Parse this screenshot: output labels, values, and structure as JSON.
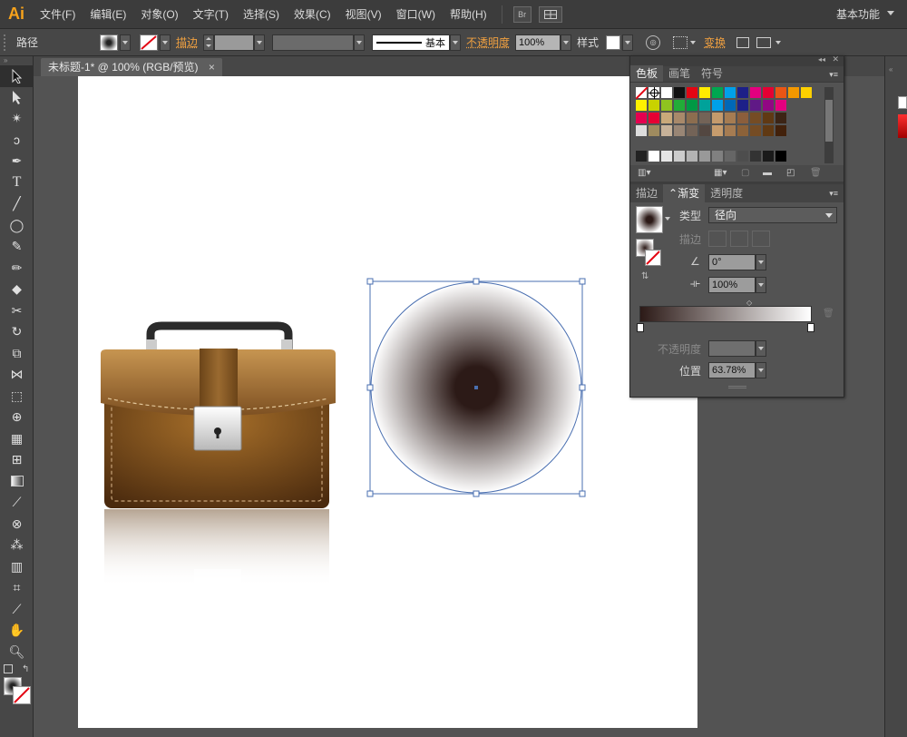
{
  "app": {
    "logo": "Ai",
    "workspace": "基本功能"
  },
  "menu": {
    "items": [
      "文件(F)",
      "编辑(E)",
      "对象(O)",
      "文字(T)",
      "选择(S)",
      "效果(C)",
      "视图(V)",
      "窗口(W)",
      "帮助(H)"
    ],
    "bridge": "Br"
  },
  "control": {
    "object_type": "路径",
    "stroke_label": "描边",
    "stroke_style": "基本",
    "opacity_label": "不透明度",
    "opacity_value": "100%",
    "style_label": "样式",
    "transform_label": "变换"
  },
  "document": {
    "tab_title": "未标题-1* @ 100% (RGB/预览)",
    "close": "×"
  },
  "swatch_panel": {
    "tabs": [
      "色板",
      "画笔",
      "符号"
    ],
    "colors": {
      "row1": [
        "#ffffff",
        "#111111",
        "#e30613",
        "#ffeb00",
        "#00a650",
        "#00a0e9",
        "#1d2088",
        "#e4007f",
        "#e60033",
        "#ea5514",
        "#f39800",
        "#fdd000"
      ],
      "row2": [
        "#fff100",
        "#c9d200",
        "#8fc31f",
        "#22ac38",
        "#009944",
        "#00a29a",
        "#00a0e9",
        "#0068b7",
        "#1d2088",
        "#601986",
        "#920783",
        "#e4007f"
      ],
      "row3": [
        "#e5004f",
        "#e60033",
        "#c9a97a",
        "#a8896a",
        "#8c6d4f",
        "#736357",
        "#c49a6c",
        "#a67c52",
        "#8b5e3c",
        "#754c24",
        "#603913",
        "#3c2415"
      ],
      "row4": [
        "#dddddd",
        "#9f8b5f",
        "#c7b299",
        "#998675",
        "#736357",
        "#534741",
        "#c69c6d",
        "#a67c52",
        "#8c6239",
        "#754c24",
        "#603913",
        "#42210b"
      ],
      "grays": [
        "#ffffff",
        "#e6e6e6",
        "#cccccc",
        "#b3b3b3",
        "#999999",
        "#808080",
        "#666666",
        "#4d4d4d",
        "#333333",
        "#1a1a1a",
        "#000000"
      ]
    }
  },
  "gradient_panel": {
    "tabs": [
      "描边",
      "渐变",
      "透明度"
    ],
    "type_label": "类型",
    "type_value": "径向",
    "stroke_label": "描边",
    "angle_value": "0°",
    "aspect_value": "100%",
    "opacity_label": "不透明度",
    "location_label": "位置",
    "location_value": "63.78%",
    "colors": {
      "start": "#2c1a17",
      "end": "#ffffff"
    }
  },
  "canvas": {
    "briefcase_colors": {
      "body": "#7a4a1a",
      "flap": "#a8742e",
      "handle": "#2a2a2a",
      "lock": "#e0e0e0"
    },
    "circle_gradient": {
      "center": "#2c1a17",
      "edge": "#ffffff",
      "stop": 0.6378
    }
  }
}
